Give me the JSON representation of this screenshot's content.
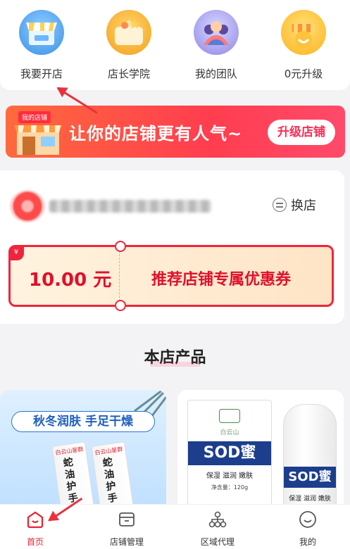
{
  "quick_entries": [
    {
      "label": "我要开店",
      "icon": "shop-awning-icon"
    },
    {
      "label": "店长学院",
      "icon": "wallet-star-icon"
    },
    {
      "label": "我的团队",
      "icon": "team-icon"
    },
    {
      "label": "0元升级",
      "icon": "crown-smile-icon"
    }
  ],
  "banner": {
    "badge": "我的店铺",
    "text": "让你的店铺更有人气~",
    "button": "升级店铺"
  },
  "store": {
    "switch_label": "换店",
    "coupon": {
      "tag": "¥",
      "amount": "10.00 元",
      "title": "推荐店铺专属优惠券"
    }
  },
  "section_title": "本店产品",
  "products": [
    {
      "tag": "秋冬润肤  手足干燥",
      "tube_brand": "白云山星群",
      "tube_name": "蛇油护手霜"
    },
    {
      "box_brand": "白云山",
      "band_text": "SOD蜜",
      "features": "保湿  滋润  嫩肤",
      "volume": "净含量：120g",
      "bottle_text": "SOD蜜",
      "bottle_features": "保湿 滋润 嫩肤"
    }
  ],
  "tabbar": [
    {
      "label": "首页",
      "active": true
    },
    {
      "label": "店铺管理",
      "active": false
    },
    {
      "label": "区域代理",
      "active": false
    },
    {
      "label": "我的",
      "active": false
    }
  ],
  "colors": {
    "accent": "#e8212f",
    "banner": "#ff3d4f",
    "coupon_border": "#f0253d"
  }
}
